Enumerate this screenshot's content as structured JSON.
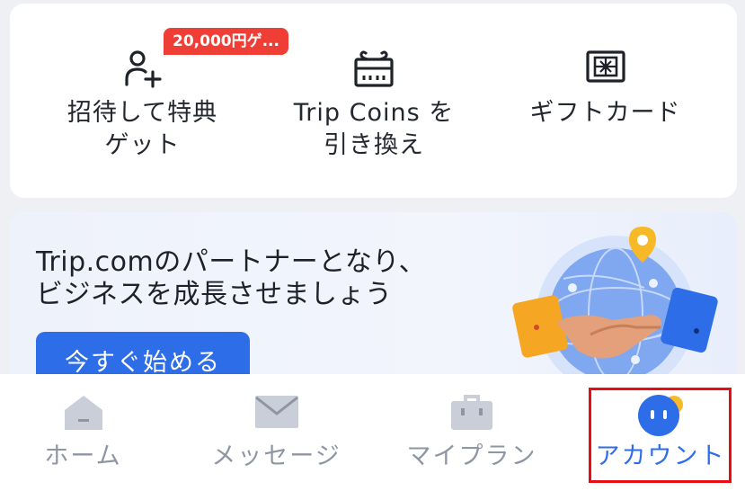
{
  "quick_actions": {
    "invite": {
      "badge": "20,000円ゲ...",
      "label": "招待して特典\nゲット",
      "icon": "add-user-icon"
    },
    "coins": {
      "label": "Trip Coins を\n引き換え",
      "icon": "gift-box-icon"
    },
    "giftcard": {
      "label": "ギフトカード",
      "icon": "gift-card-icon"
    }
  },
  "partner_banner": {
    "title": "Trip.comのパートナーとなり、\nビジネスを成長させましょう",
    "button_label": "今すぐ始める",
    "illustration": "handshake-globe-illustration"
  },
  "tabbar": {
    "tabs": [
      {
        "label": "ホーム",
        "icon": "home-icon",
        "active": false
      },
      {
        "label": "メッセージ",
        "icon": "mail-icon",
        "active": false
      },
      {
        "label": "マイプラン",
        "icon": "briefcase-icon",
        "active": false
      },
      {
        "label": "アカウント",
        "icon": "account-icon",
        "active": true
      }
    ]
  },
  "colors": {
    "accent": "#2d6ee8",
    "badge": "#ef3e35",
    "inactive": "#8f96a3",
    "highlight": "#e80c14"
  }
}
